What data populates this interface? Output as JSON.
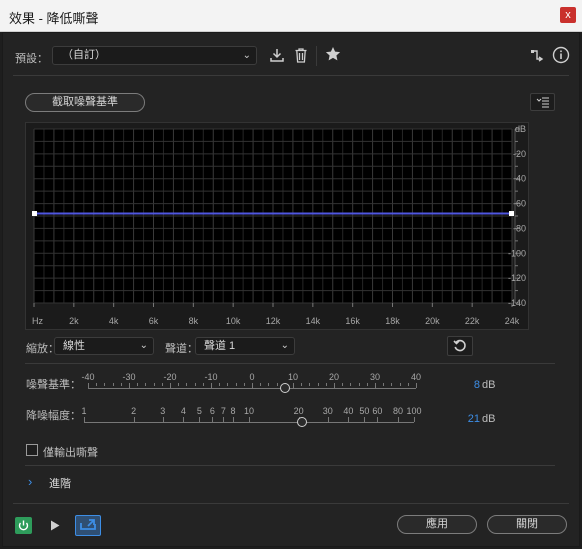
{
  "window": {
    "title": "效果 - 降低嘶聲",
    "close_glyph": "x"
  },
  "preset": {
    "label": "預設：",
    "value": "（自訂）"
  },
  "capture_button_label": "截取噪聲基準",
  "graph": {
    "x_ticks": [
      "Hz",
      "2k",
      "4k",
      "6k",
      "8k",
      "10k",
      "12k",
      "14k",
      "16k",
      "18k",
      "20k",
      "22k",
      "24k"
    ],
    "y_ticks": [
      "dB",
      "-20",
      "-40",
      "-60",
      "-80",
      "-100",
      "-120",
      "-140"
    ],
    "curve_level_db": -68
  },
  "zoom": {
    "label": "縮放：",
    "value": "線性"
  },
  "channel": {
    "label": "聲道：",
    "value": "聲道 1"
  },
  "noise_floor": {
    "label": "噪聲基準：",
    "scale": [
      "-40",
      "-30",
      "-20",
      "-10",
      "0",
      "10",
      "20",
      "30",
      "40"
    ],
    "value": "8",
    "unit": "dB"
  },
  "reduce_by": {
    "label": "降噪幅度：",
    "scale": [
      "1",
      "2",
      "3",
      "4",
      "5",
      "6",
      "7",
      "8",
      "10",
      "20",
      "30",
      "40",
      "50",
      "60",
      "80",
      "100"
    ],
    "value": "21",
    "unit": "dB"
  },
  "output_hiss_only": {
    "label": "僅輸出嘶聲",
    "checked": false
  },
  "advanced": {
    "label": "進階"
  },
  "footer": {
    "apply_label": "應用",
    "close_label": "關閉"
  },
  "colors": {
    "accent": "#3d8ee6",
    "power": "#2e9c5b",
    "curve": "#4f56e0"
  }
}
